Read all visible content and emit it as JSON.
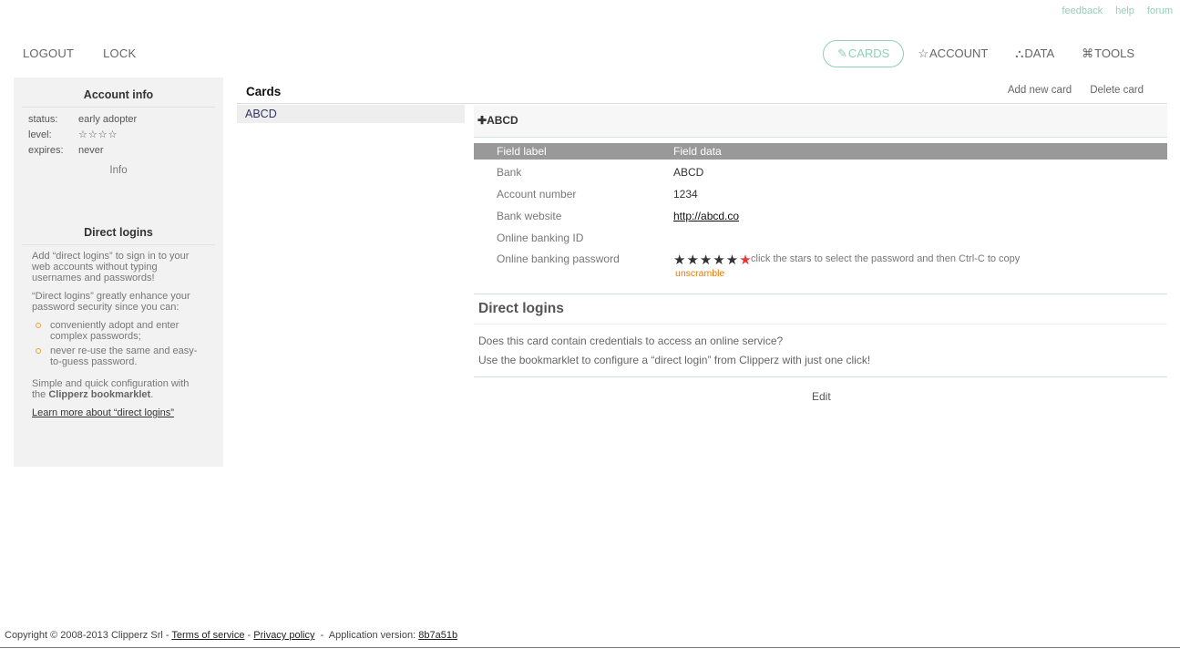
{
  "top_links": [
    "feedback",
    "help",
    "forum"
  ],
  "left_nav": {
    "logout": "LOGOUT",
    "lock": "LOCK"
  },
  "tabs": [
    {
      "icon": "✎",
      "label": "CARDS",
      "active": true
    },
    {
      "icon": "☆",
      "label": "ACCOUNT",
      "active": false
    },
    {
      "icon": "⛬",
      "label": "DATA",
      "active": false
    },
    {
      "icon": "⌘",
      "label": "TOOLS",
      "active": false
    }
  ],
  "sidebar": {
    "account_info": {
      "title": "Account info",
      "rows": [
        {
          "key": "status:",
          "value": "early adopter"
        },
        {
          "key": "level:",
          "value": "☆☆☆☆"
        },
        {
          "key": "expires:",
          "value": "never"
        }
      ],
      "info_link": "Info"
    },
    "direct_logins": {
      "title": "Direct logins",
      "p1": "Add “direct logins” to sign in to your web accounts without typing usernames and passwords!",
      "p2": "“Direct logins” greatly enhance your password security since you can:",
      "bullets": [
        "conveniently adopt and enter complex passwords;",
        "never re-use the same and easy-to-guess password."
      ],
      "p3_prefix": "Simple and quick configuration with the ",
      "p3_bold": "Clipperz bookmarklet",
      "p3_suffix": ".",
      "learn_link": "Learn more about “direct logins”"
    }
  },
  "cards": {
    "title": "Cards",
    "items": [
      "ABCD"
    ],
    "actions": {
      "add": "Add new card",
      "delete": "Delete card"
    }
  },
  "detail": {
    "title_icon": "✚",
    "title": "ABCD",
    "header": {
      "label": "Field label",
      "data": "Field data"
    },
    "fields": [
      {
        "label": "Bank",
        "value": "ABCD"
      },
      {
        "label": "Account number",
        "value": "1234"
      },
      {
        "label": "Bank website",
        "value": "http://abcd.co"
      },
      {
        "label": "Online banking ID",
        "value": ""
      },
      {
        "label": "Online banking password",
        "value": "★★★★★"
      }
    ],
    "password_red_star": "★",
    "password_hint": "click the stars to select the password and then Ctrl-C to copy",
    "unscramble": "unscramble",
    "direct_logins": {
      "title": "Direct logins",
      "line1": "Does this card contain credentials to access an online service?",
      "line2": "Use the bookmarklet to configure a “direct login” from Clipperz with just one click!"
    },
    "edit": "Edit"
  },
  "footer": {
    "copyright": "Copyright © 2008-2013 Clipperz Srl - ",
    "terms": "Terms of service",
    "dash": " - ",
    "privacy": "Privacy policy",
    "version_label": "  -  Application version: ",
    "version": "8b7a51b"
  },
  "colors": {
    "accent": "#8fd0b5",
    "unscramble": "#f07800",
    "header_bg": "#999999"
  }
}
